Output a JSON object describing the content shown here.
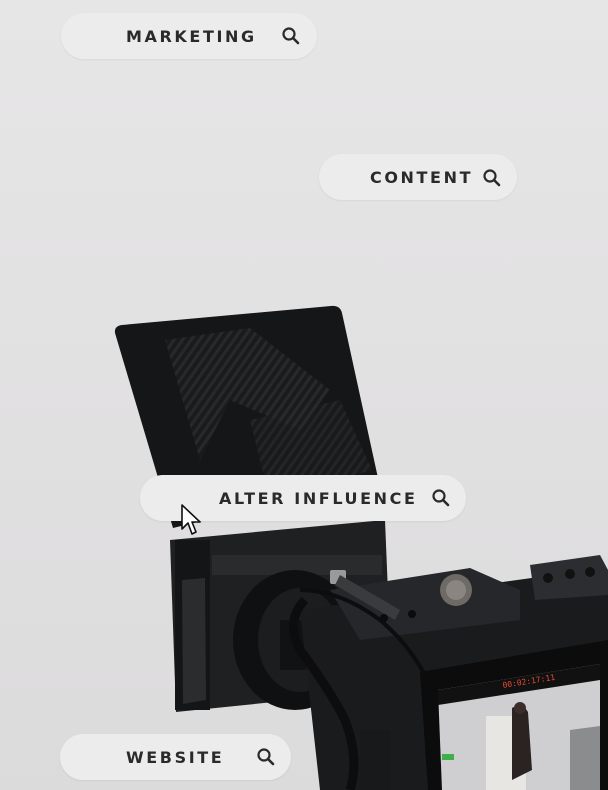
{
  "search_pills": [
    {
      "label": "MARKETING",
      "icon": "search-icon"
    },
    {
      "label": "CONTENT",
      "icon": "search-icon"
    },
    {
      "label": "ALTER INFLUENCE",
      "icon": "search-icon"
    },
    {
      "label": "WEBSITE",
      "icon": "search-icon"
    }
  ],
  "camera_display": {
    "timecode": "00:02:17:11"
  },
  "colors": {
    "pill_background": "#ececec",
    "pill_text": "#2a2a2a",
    "backdrop": "#e3e2e3"
  },
  "cursor_icon": "arrow-pointer-icon"
}
